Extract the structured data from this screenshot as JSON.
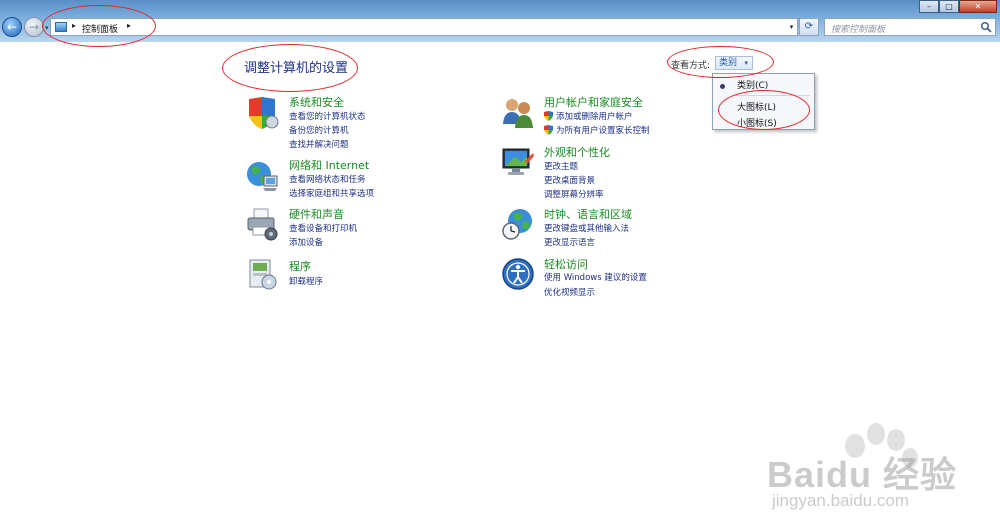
{
  "window": {
    "min_glyph": "–",
    "max_glyph": "□",
    "close_glyph": "✕"
  },
  "nav": {
    "back_glyph": "←",
    "forward_glyph": "→",
    "recent_glyph": "▾"
  },
  "address": {
    "separator": "▸",
    "location": "控制面板",
    "drop_glyph": "▾",
    "refresh_glyph": "⟳"
  },
  "search": {
    "placeholder": "搜索控制面板"
  },
  "main": {
    "title": "调整计算机的设置"
  },
  "view": {
    "label": "查看方式:",
    "selected": "类别",
    "arrow": "▾"
  },
  "view_menu": {
    "items": [
      "类别(C)",
      "大图标(L)",
      "小图标(S)"
    ]
  },
  "categories": [
    {
      "title": "系统和安全",
      "icon": "shield-icon",
      "links": [
        "查看您的计算机状态",
        "备份您的计算机",
        "查找并解决问题"
      ]
    },
    {
      "title": "网络和 Internet",
      "icon": "network-globe-icon",
      "links": [
        "查看网络状态和任务",
        "选择家庭组和共享选项"
      ]
    },
    {
      "title": "硬件和声音",
      "icon": "printer-icon",
      "links": [
        "查看设备和打印机",
        "添加设备"
      ]
    },
    {
      "title": "程序",
      "icon": "programs-icon",
      "links": [
        "卸载程序"
      ]
    },
    {
      "title": "用户帐户和家庭安全",
      "icon": "users-icon",
      "links": [
        "添加或删除用户帐户",
        "为所有用户设置家长控制"
      ]
    },
    {
      "title": "外观和个性化",
      "icon": "monitor-icon",
      "links": [
        "更改主题",
        "更改桌面背景",
        "调整屏幕分辨率"
      ]
    },
    {
      "title": "时钟、语言和区域",
      "icon": "clock-globe-icon",
      "links": [
        "更改键盘或其他输入法",
        "更改显示语言"
      ]
    },
    {
      "title": "轻松访问",
      "icon": "ease-of-access-icon",
      "links": [
        "使用 Windows 建议的设置",
        "优化视频显示"
      ]
    }
  ],
  "watermark": {
    "text": "Baidu 经验",
    "url": "jingyan.baidu.com"
  },
  "colors": {
    "title_green": "#1a8a22",
    "link_blue": "#1e3287",
    "annotation_red": "#e0282a"
  }
}
